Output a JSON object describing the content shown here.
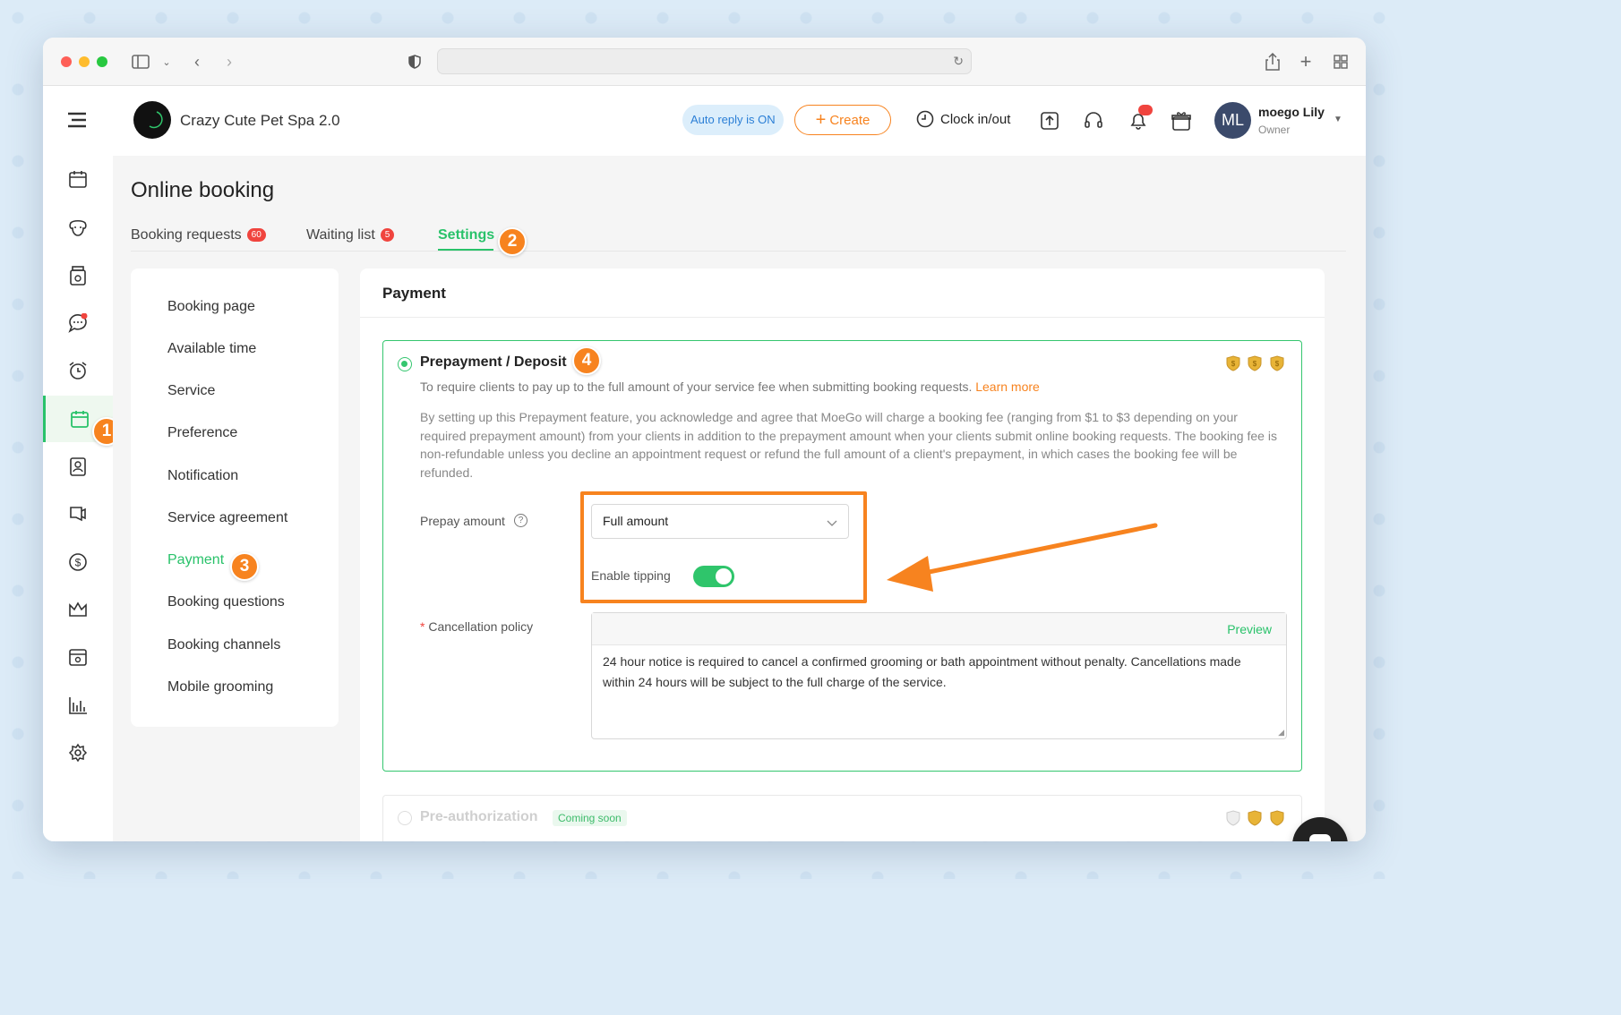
{
  "app": {
    "business_name": "Crazy Cute Pet Spa 2.0",
    "auto_reply": "Auto reply is ON",
    "create": "Create",
    "clock": "Clock in/out",
    "user_name": "moego Lily",
    "user_role": "Owner",
    "avatar_initials": "ML"
  },
  "page": {
    "title": "Online booking",
    "tabs": [
      {
        "label": "Booking requests",
        "count": "60"
      },
      {
        "label": "Waiting list",
        "count": "5"
      },
      {
        "label": "Settings"
      }
    ]
  },
  "submenu": {
    "items": [
      "Booking page",
      "Available time",
      "Service",
      "Preference",
      "Notification",
      "Service agreement",
      "Payment",
      "Booking questions",
      "Booking channels",
      "Mobile grooming"
    ]
  },
  "payment": {
    "title": "Payment",
    "option1_title": "Prepayment / Deposit",
    "option1_desc": "To require clients to pay up to the full amount of your service fee when submitting booking requests.",
    "learn_more": "Learn more",
    "notice": "By setting up this Prepayment feature, you acknowledge and agree that MoeGo will charge a booking fee (ranging from $1 to $3 depending on your required prepayment amount) from your clients in addition to the prepayment amount when your clients submit online booking requests. The booking fee is non-refundable unless you decline an appointment request or refund the full amount of a client's prepayment, in which cases the booking fee will be refunded.",
    "prepay_label": "Prepay amount",
    "prepay_value": "Full amount",
    "tipping_label": "Enable tipping",
    "tipping_on": true,
    "cancel_required": "*",
    "cancel_label": "Cancellation policy",
    "preview": "Preview",
    "cancel_text": "24 hour notice is required to cancel a confirmed grooming or bath appointment without penalty. Cancellations made within 24 hours will be subject to the full charge of the service.",
    "option2_title": "Pre-authorization",
    "option2_badge": "Coming soon"
  },
  "annotations": [
    "1",
    "2",
    "3",
    "4"
  ],
  "colors": {
    "accent_green": "#29c26a",
    "accent_orange": "#f7831f",
    "badge_red": "#f0443e"
  }
}
